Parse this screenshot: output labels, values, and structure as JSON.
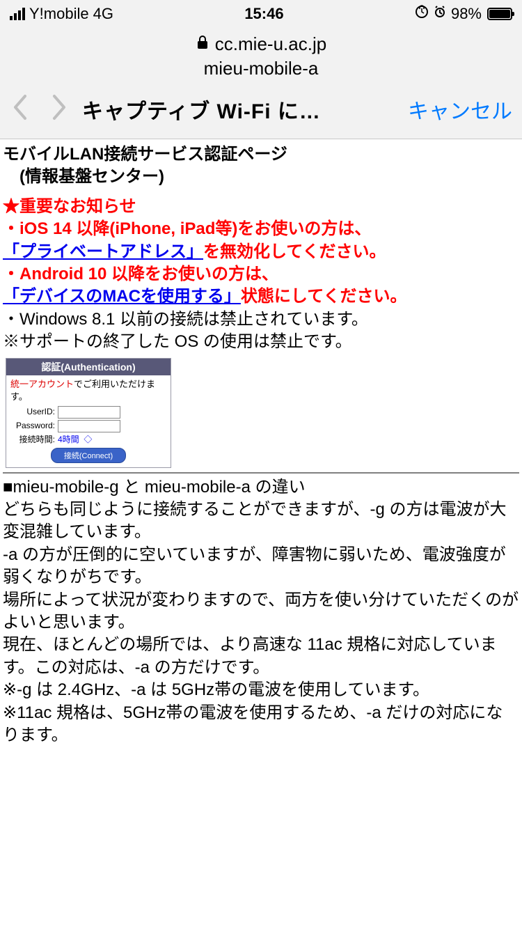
{
  "status": {
    "carrier": "Y!mobile",
    "net": "4G",
    "time": "15:46",
    "batt_pct": "98%"
  },
  "header": {
    "domain": "cc.mie-u.ac.jp",
    "ssid": "mieu-mobile-a",
    "title": "キャプティブ Wi-Fi に…",
    "cancel": "キャンセル"
  },
  "page": {
    "title1": "モバイルLAN接続サービス認証ページ",
    "title2": "　(情報基盤センター)",
    "notice_head": "★重要なお知らせ",
    "ios_prefix": "・iOS 14 以降(iPhone, iPad等)をお使いの方は、",
    "ios_link": "「プライベートアドレス」",
    "ios_suffix": "を無効化してください。",
    "android_prefix": "・Android 10 以降をお使いの方は、",
    "android_link": "「デバイスのMACを使用する」",
    "android_suffix": "状態にしてください。",
    "win81": "・Windows 8.1 以前の接続は禁止されています。",
    "os_note": "※サポートの終了した OS の使用は禁止です。"
  },
  "auth": {
    "title": "認証(Authentication)",
    "note_pre": "統一アカウント",
    "note_post": "でご利用いただけます。",
    "userid_label": "UserID:",
    "password_label": "Password:",
    "time_label": "接続時間:",
    "time_value": "4時間",
    "connect": "接続(Connect)"
  },
  "diff": {
    "heading": "■mieu-mobile-g と mieu-mobile-a の違い",
    "p1": "どちらも同じように接続することができますが、-g の方は電波が大変混雑しています。",
    "p2": "-a の方が圧倒的に空いていますが、障害物に弱いため、電波強度が弱くなりがちです。",
    "p3": "場所によって状況が変わりますので、両方を使い分けていただくのがよいと思います。",
    "p4": "現在、ほとんどの場所では、より高速な 11ac 規格に対応しています。この対応は、-a の方だけです。",
    "n1": "※-g は 2.4GHz、-a は 5GHz帯の電波を使用しています。",
    "n2": "※11ac 規格は、5GHz帯の電波を使用するため、-a だけの対応になります。"
  }
}
